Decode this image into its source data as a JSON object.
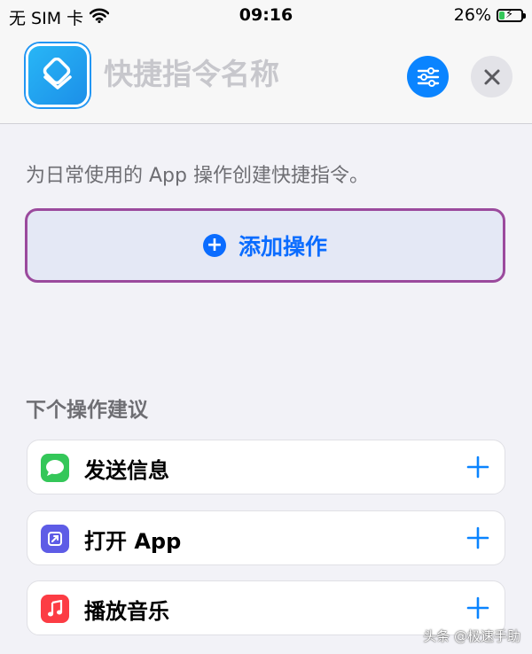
{
  "status_bar": {
    "carrier": "无 SIM 卡",
    "time": "09:16",
    "battery_percent": "26%",
    "battery_level": 0.26
  },
  "header": {
    "title_placeholder": "快捷指令名称",
    "app_icon": "shortcuts-icon",
    "settings_icon": "sliders-icon",
    "close_icon": "close-icon"
  },
  "editor": {
    "description": "为日常使用的 App 操作创建快捷指令。",
    "add_action_label": "添加操作"
  },
  "suggestions": {
    "title": "下个操作建议",
    "items": [
      {
        "label": "发送信息",
        "icon": "messages-icon",
        "color": "#34c759"
      },
      {
        "label": "打开 App",
        "icon": "open-app-icon",
        "color": "#5e5ce6"
      },
      {
        "label": "播放音乐",
        "icon": "music-icon",
        "color": "#fc3c44"
      }
    ]
  },
  "watermark": "头条 @极速手助",
  "colors": {
    "accent": "#0a84ff",
    "add_action_border": "#9b4a9d",
    "add_action_bg": "#e4e8f5"
  }
}
